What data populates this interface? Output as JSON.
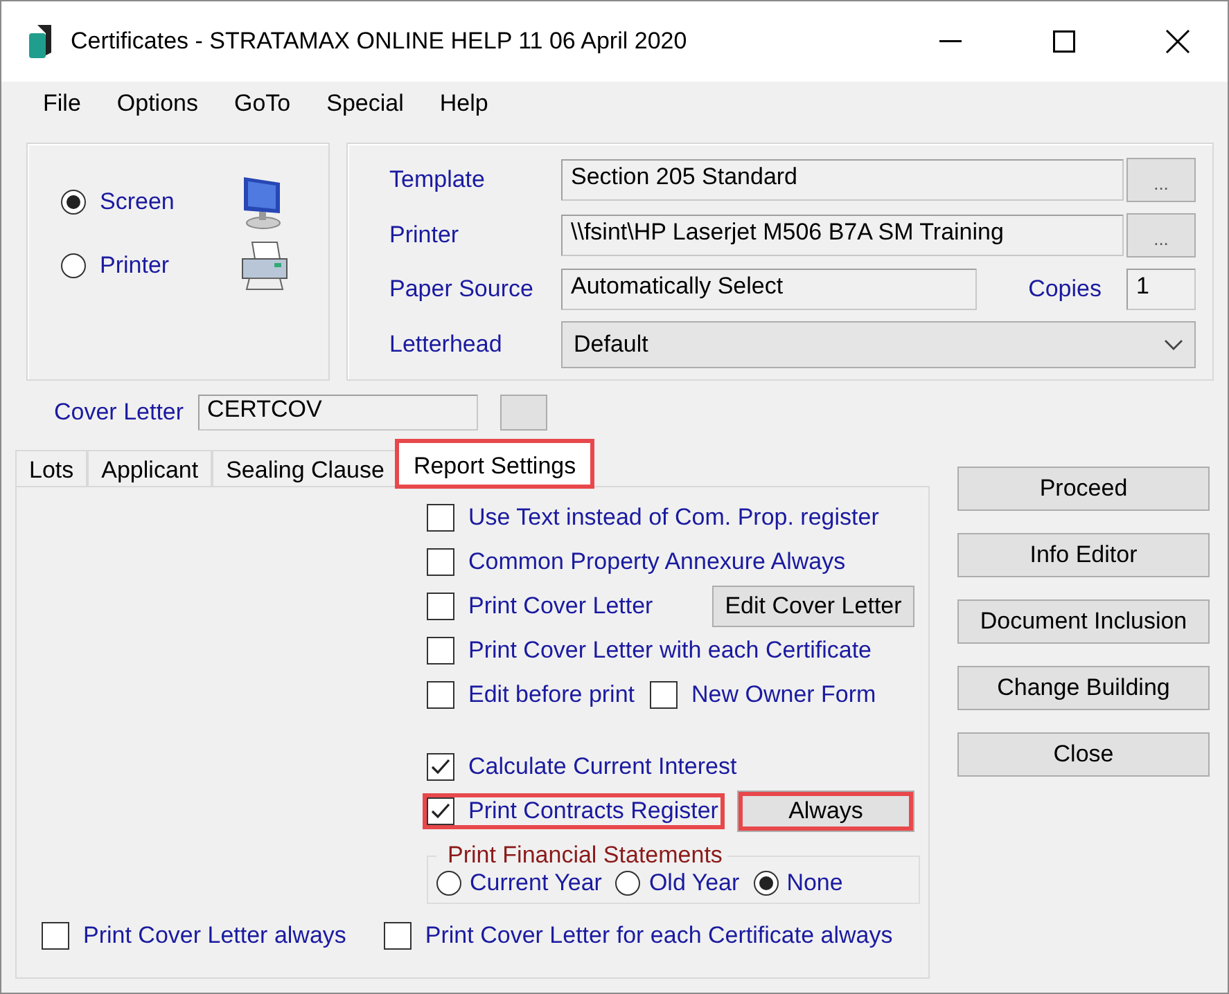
{
  "window": {
    "title": "Certificates - STRATAMAX ONLINE HELP 11 06 April 2020"
  },
  "menu": [
    "File",
    "Options",
    "GoTo",
    "Special",
    "Help"
  ],
  "output": [
    {
      "label": "Screen",
      "selected": true,
      "kind": "monitor"
    },
    {
      "label": "Printer",
      "selected": false,
      "kind": "printer"
    }
  ],
  "settings": {
    "template": {
      "label": "Template",
      "value": "Section 205 Standard",
      "browse": "..."
    },
    "printer": {
      "label": "Printer",
      "value": "\\\\fsint\\HP Laserjet M506 B7A SM Training",
      "browse": "..."
    },
    "paper_source": {
      "label": "Paper Source",
      "value": "Automatically Select"
    },
    "copies": {
      "label": "Copies",
      "value": "1"
    },
    "letterhead": {
      "label": "Letterhead",
      "value": "Default"
    }
  },
  "cover_letter": {
    "label": "Cover Letter",
    "value": "CERTCOV"
  },
  "tabs": [
    {
      "label": "Lots",
      "selected": false,
      "highlighted": false
    },
    {
      "label": "Applicant",
      "selected": false,
      "highlighted": false
    },
    {
      "label": "Sealing Clause",
      "selected": false,
      "highlighted": false
    },
    {
      "label": "Report Settings",
      "selected": true,
      "highlighted": true
    }
  ],
  "option_groups": [
    [
      [
        {
          "kind": "checkbox",
          "label": "Use Text instead of Com. Prop. register",
          "checked": false,
          "highlighted": false
        }
      ],
      [
        {
          "kind": "checkbox",
          "label": "Common Property Annexure Always",
          "checked": false,
          "highlighted": false
        }
      ],
      [
        {
          "kind": "checkbox",
          "label": "Print Cover Letter",
          "checked": false,
          "highlighted": false
        },
        {
          "kind": "button",
          "label": "Edit Cover Letter",
          "highlighted": false
        }
      ],
      [
        {
          "kind": "checkbox",
          "label": "Print Cover Letter with each Certificate",
          "checked": false,
          "highlighted": false
        }
      ],
      [
        {
          "kind": "checkbox",
          "label": "Edit before print",
          "checked": false,
          "highlighted": false
        },
        {
          "kind": "checkbox",
          "label": "New Owner Form",
          "checked": false,
          "highlighted": false
        }
      ]
    ],
    [
      [
        {
          "kind": "checkbox",
          "label": "Calculate Current Interest",
          "checked": true,
          "highlighted": false
        }
      ],
      [
        {
          "kind": "checkbox",
          "label": "Print Contracts Register",
          "checked": true,
          "highlighted": true
        },
        {
          "kind": "button",
          "label": "Always",
          "highlighted": true
        }
      ]
    ]
  ],
  "financial_statements": {
    "title": "Print Financial Statements",
    "options": [
      {
        "label": "Current Year",
        "selected": false
      },
      {
        "label": "Old Year",
        "selected": false
      },
      {
        "label": "None",
        "selected": true
      }
    ]
  },
  "bottom_options": [
    {
      "label": "Print Cover Letter always",
      "checked": false
    },
    {
      "label": "Print Cover Letter for each Certificate always",
      "checked": false
    }
  ],
  "actions": [
    "Proceed",
    "Info Editor",
    "Document Inclusion",
    "Change Building",
    "Close"
  ]
}
